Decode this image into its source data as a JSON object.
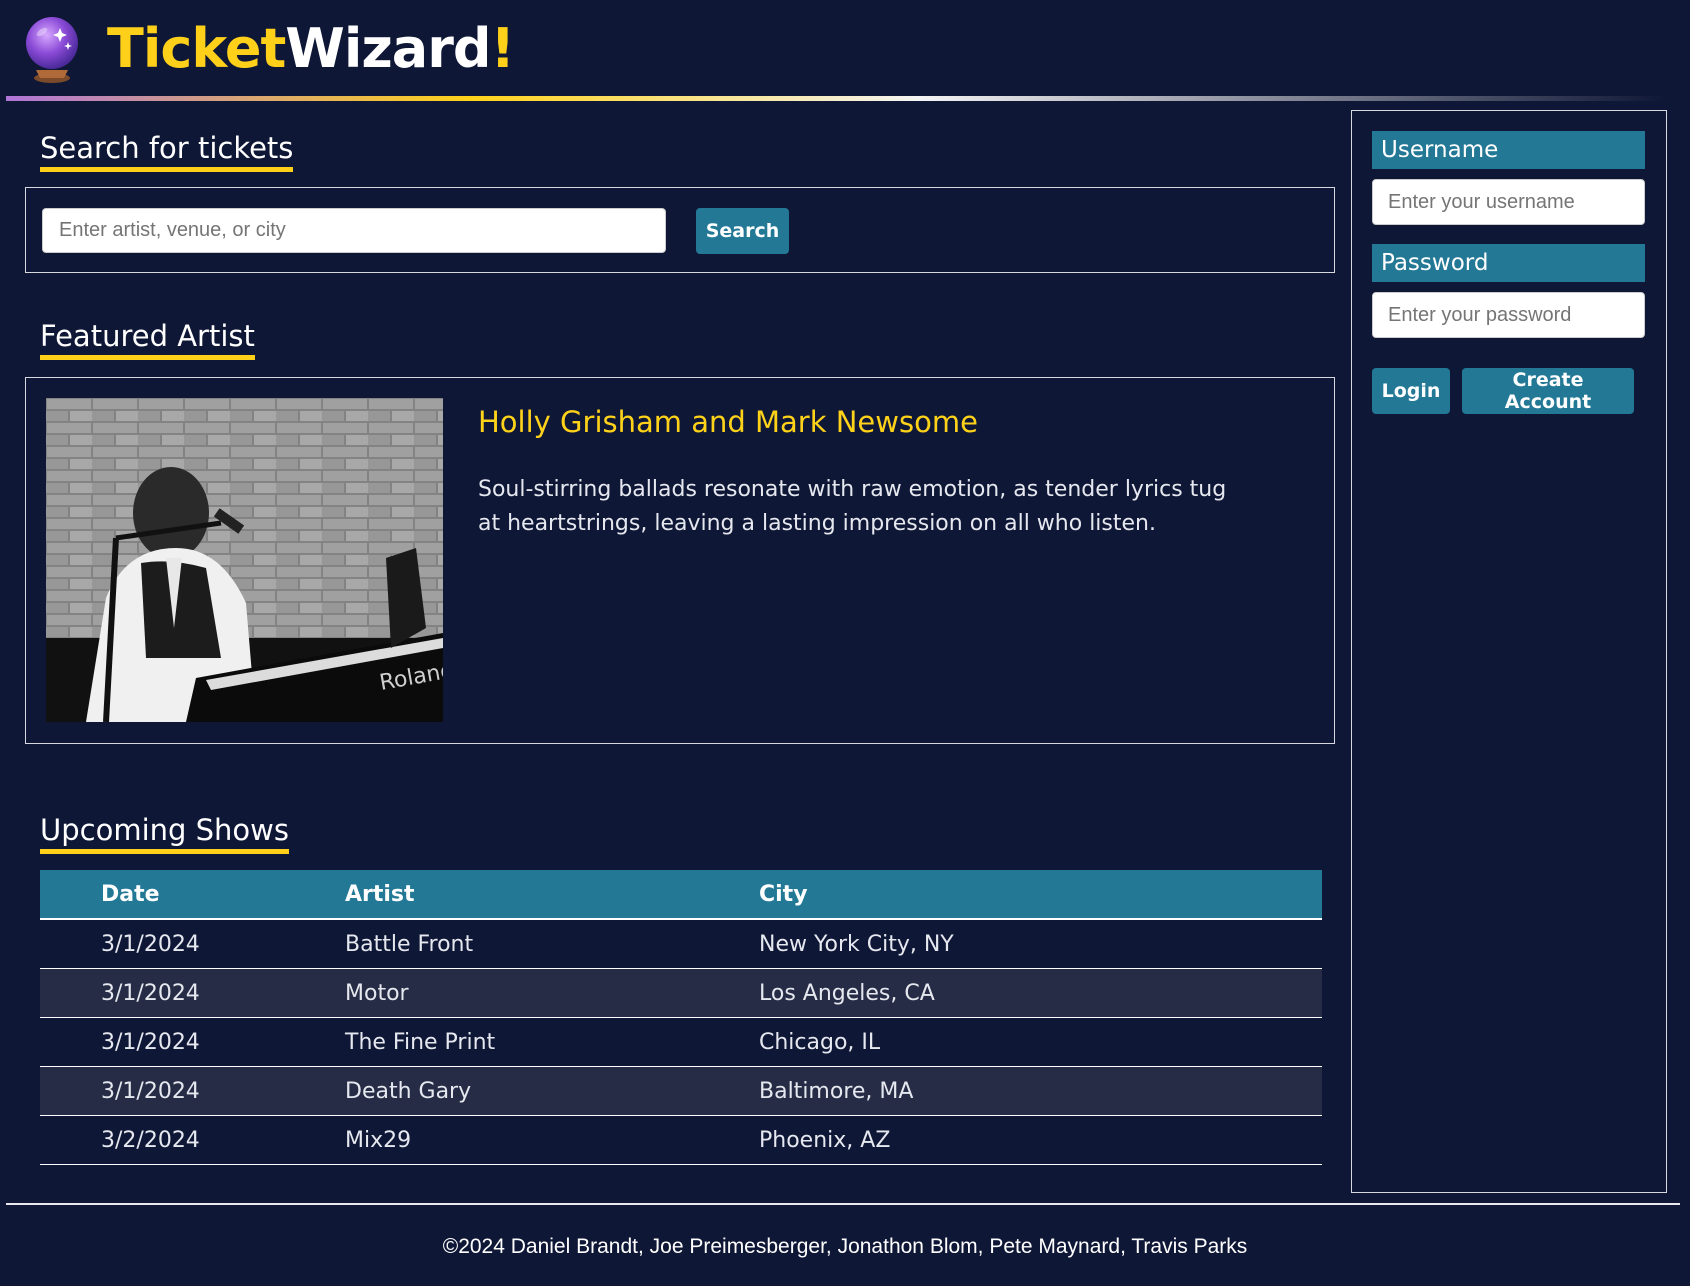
{
  "header": {
    "brand_part1": "Ticket",
    "brand_part2": "Wizard",
    "brand_part3": "!",
    "logo_icon": "crystal-ball-icon"
  },
  "search": {
    "title": "Search for tickets",
    "placeholder": "Enter artist, venue, or city",
    "button_label": "Search"
  },
  "featured": {
    "title": "Featured Artist",
    "artist_name": "Holly Grisham and Mark Newsome",
    "description": "Soul-stirring ballads resonate with raw emotion, as tender lyrics tug at heartstrings, leaving a lasting impression on all who listen.",
    "photo_text": "Roland"
  },
  "shows": {
    "title": "Upcoming Shows",
    "columns": [
      "Date",
      "Artist",
      "City"
    ],
    "rows": [
      {
        "date": "3/1/2024",
        "artist": "Battle Front",
        "city": "New York City, NY"
      },
      {
        "date": "3/1/2024",
        "artist": "Motor",
        "city": "Los Angeles, CA"
      },
      {
        "date": "3/1/2024",
        "artist": "The Fine Print",
        "city": "Chicago, IL"
      },
      {
        "date": "3/1/2024",
        "artist": "Death Gary",
        "city": "Baltimore, MA"
      },
      {
        "date": "3/2/2024",
        "artist": "Mix29",
        "city": "Phoenix, AZ"
      }
    ]
  },
  "login": {
    "username_label": "Username",
    "username_placeholder": "Enter your username",
    "password_label": "Password",
    "password_placeholder": "Enter your password",
    "login_button": "Login",
    "create_button": "Create Account"
  },
  "footer": {
    "text": "©2024 Daniel Brandt, Joe Preimesberger, Jonathon Blom, Pete Maynard, Travis Parks"
  },
  "colors": {
    "background": "#0f1736",
    "accent_yellow": "#ffd01a",
    "accent_teal": "#237896",
    "row_alt": "#262c45"
  }
}
